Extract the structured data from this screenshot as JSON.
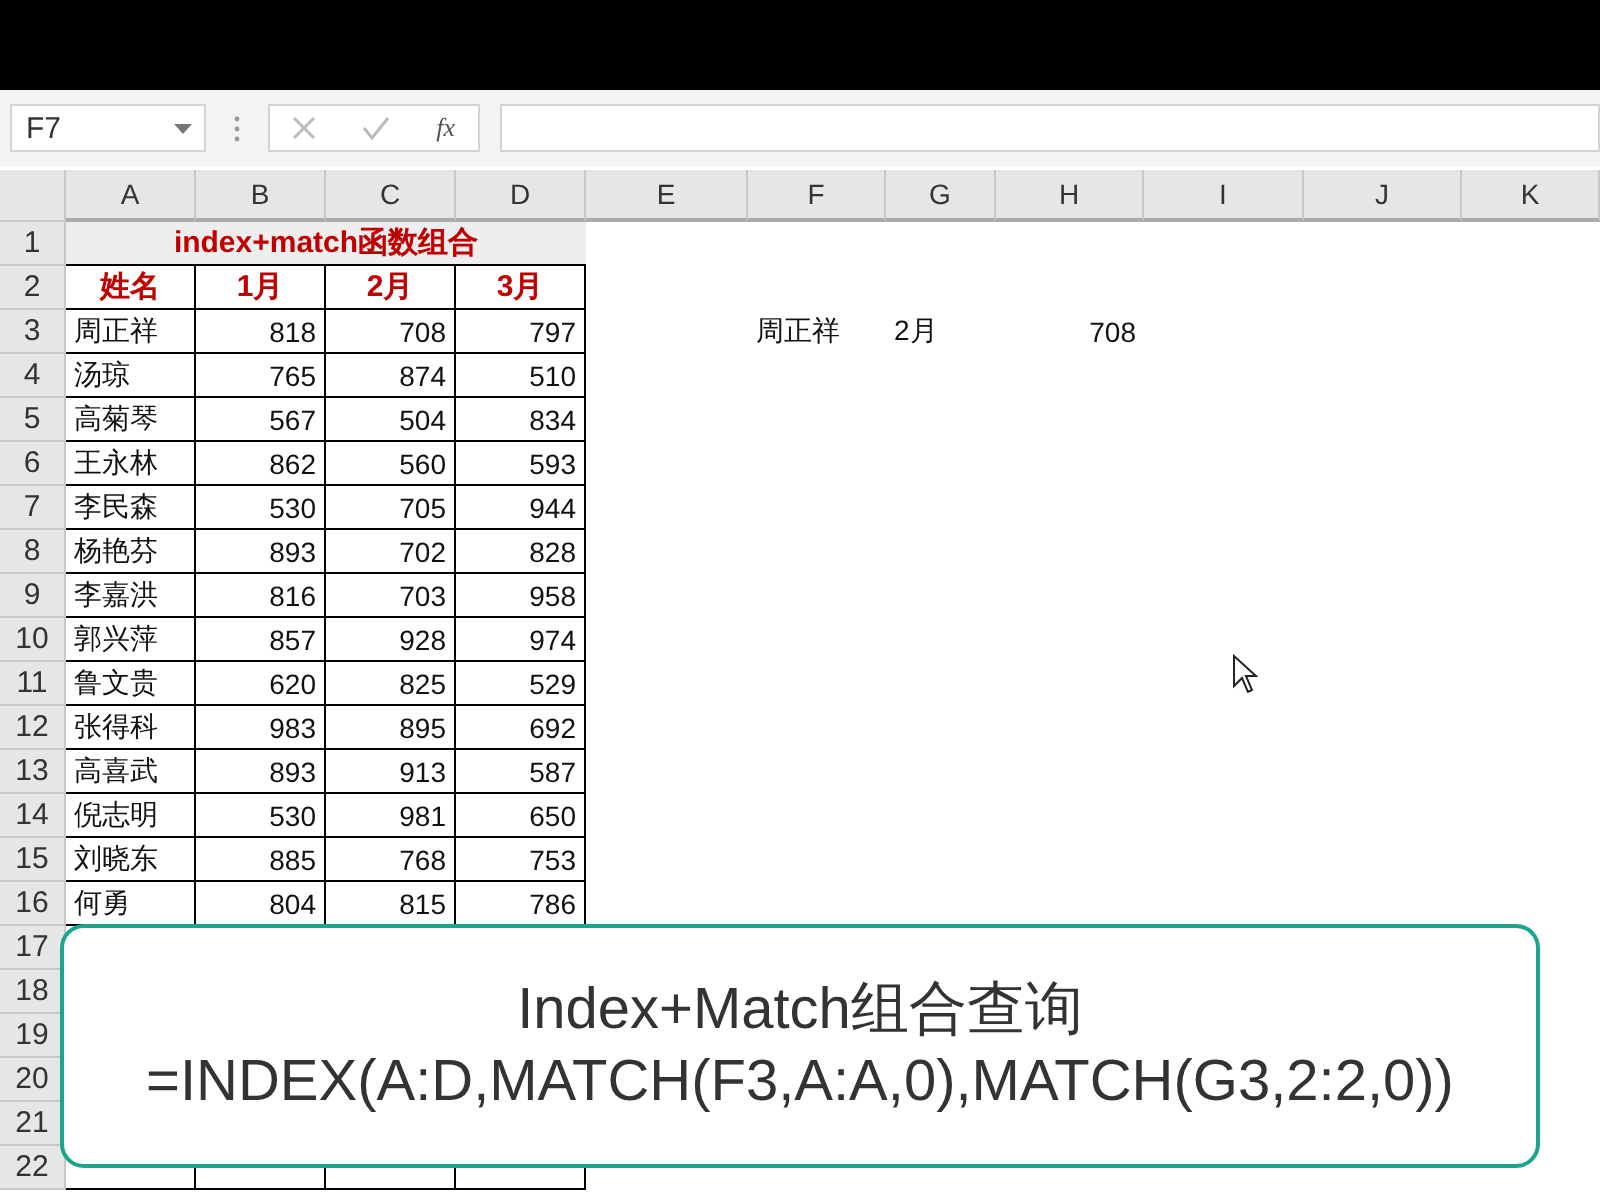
{
  "name_box": {
    "value": "F7"
  },
  "formula_bar": {
    "fx_label": "fx"
  },
  "columns": [
    "A",
    "B",
    "C",
    "D",
    "E",
    "F",
    "G",
    "H",
    "I",
    "J",
    "K"
  ],
  "row_numbers": [
    "1",
    "2",
    "3",
    "4",
    "5",
    "6",
    "7",
    "8",
    "9",
    "10",
    "11",
    "12",
    "13",
    "14",
    "15",
    "16",
    "17",
    "18",
    "19",
    "20",
    "21",
    "22"
  ],
  "table": {
    "title": "index+match函数组合",
    "headers": [
      "姓名",
      "1月",
      "2月",
      "3月"
    ],
    "rows": [
      [
        "周正祥",
        "818",
        "708",
        "797"
      ],
      [
        "汤琼",
        "765",
        "874",
        "510"
      ],
      [
        "高菊琴",
        "567",
        "504",
        "834"
      ],
      [
        "王永林",
        "862",
        "560",
        "593"
      ],
      [
        "李民森",
        "530",
        "705",
        "944"
      ],
      [
        "杨艳芬",
        "893",
        "702",
        "828"
      ],
      [
        "李嘉洪",
        "816",
        "703",
        "958"
      ],
      [
        "郭兴萍",
        "857",
        "928",
        "974"
      ],
      [
        "鲁文贵",
        "620",
        "825",
        "529"
      ],
      [
        "张得科",
        "983",
        "895",
        "692"
      ],
      [
        "高喜武",
        "893",
        "913",
        "587"
      ],
      [
        "倪志明",
        "530",
        "981",
        "650"
      ],
      [
        "刘晓东",
        "885",
        "768",
        "753"
      ],
      [
        "何勇",
        "804",
        "815",
        "786"
      ]
    ]
  },
  "lookup": {
    "name": "周正祥",
    "month": "2月",
    "result": "708"
  },
  "caption": {
    "title": "Index+Match组合查询",
    "formula": "=INDEX(A:D,MATCH(F3,A:A,0),MATCH(G3,2:2,0))"
  }
}
